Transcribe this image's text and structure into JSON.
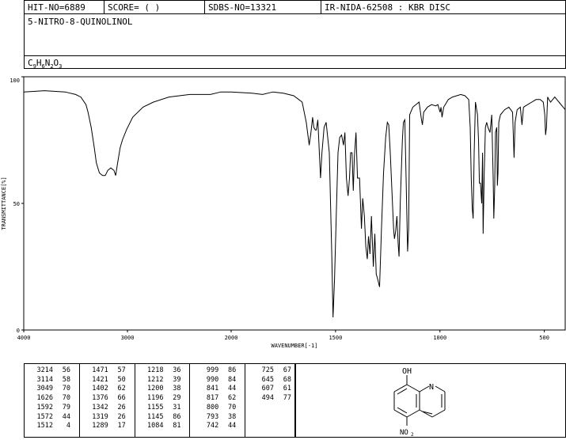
{
  "header": {
    "hit": "HIT-NO=6889",
    "score": "SCORE=  (   )",
    "sdbs": "SDBS-NO=13321",
    "ir": "IR-NIDA-62508 : KBR DISC"
  },
  "compound": {
    "name": "5-NITRO-8-QUINOLINOL",
    "formula_parts": [
      "C",
      "9",
      "H",
      "6",
      "N",
      "2",
      "O",
      "3"
    ]
  },
  "chart_data": {
    "type": "line",
    "xlabel": "WAVENUMBER[-1]",
    "ylabel": "TRANSMITTANCE[%]",
    "xlim": [
      4000,
      400
    ],
    "ylim": [
      0,
      100
    ],
    "x_ticks": [
      4000,
      3000,
      2000,
      1500,
      1000,
      500
    ],
    "y_ticks": [
      0,
      50,
      100
    ],
    "series": [
      {
        "points": [
          [
            4000,
            94
          ],
          [
            3800,
            94.5
          ],
          [
            3600,
            94
          ],
          [
            3500,
            93
          ],
          [
            3450,
            92
          ],
          [
            3400,
            89
          ],
          [
            3380,
            86
          ],
          [
            3350,
            80
          ],
          [
            3320,
            72
          ],
          [
            3300,
            66
          ],
          [
            3270,
            62
          ],
          [
            3240,
            61
          ],
          [
            3214,
            61
          ],
          [
            3190,
            63
          ],
          [
            3160,
            64
          ],
          [
            3130,
            63
          ],
          [
            3114,
            61
          ],
          [
            3095,
            66
          ],
          [
            3070,
            72
          ],
          [
            3049,
            75
          ],
          [
            3010,
            79
          ],
          [
            2950,
            84
          ],
          [
            2850,
            88
          ],
          [
            2750,
            90
          ],
          [
            2600,
            92
          ],
          [
            2400,
            93
          ],
          [
            2200,
            93
          ],
          [
            2100,
            94
          ],
          [
            2000,
            94
          ],
          [
            1900,
            93.5
          ],
          [
            1850,
            93
          ],
          [
            1800,
            94
          ],
          [
            1750,
            93.5
          ],
          [
            1700,
            92.5
          ],
          [
            1660,
            90
          ],
          [
            1640,
            82
          ],
          [
            1626,
            73
          ],
          [
            1618,
            78
          ],
          [
            1610,
            84
          ],
          [
            1604,
            80
          ],
          [
            1597,
            79
          ],
          [
            1592,
            79
          ],
          [
            1585,
            83
          ],
          [
            1572,
            60
          ],
          [
            1565,
            70
          ],
          [
            1555,
            80
          ],
          [
            1545,
            82
          ],
          [
            1530,
            70
          ],
          [
            1518,
            30
          ],
          [
            1512,
            5
          ],
          [
            1505,
            20
          ],
          [
            1495,
            50
          ],
          [
            1488,
            70
          ],
          [
            1480,
            76
          ],
          [
            1471,
            77
          ],
          [
            1462,
            73
          ],
          [
            1455,
            78
          ],
          [
            1448,
            60
          ],
          [
            1440,
            53
          ],
          [
            1433,
            60
          ],
          [
            1428,
            70
          ],
          [
            1421,
            70
          ],
          [
            1415,
            55
          ],
          [
            1410,
            68
          ],
          [
            1402,
            78
          ],
          [
            1395,
            60
          ],
          [
            1385,
            60
          ],
          [
            1376,
            40
          ],
          [
            1370,
            52
          ],
          [
            1362,
            45
          ],
          [
            1355,
            33
          ],
          [
            1348,
            28
          ],
          [
            1342,
            37
          ],
          [
            1335,
            30
          ],
          [
            1328,
            45
          ],
          [
            1319,
            25
          ],
          [
            1312,
            38
          ],
          [
            1305,
            22
          ],
          [
            1298,
            20
          ],
          [
            1289,
            17
          ],
          [
            1280,
            40
          ],
          [
            1270,
            62
          ],
          [
            1260,
            76
          ],
          [
            1252,
            82
          ],
          [
            1245,
            81
          ],
          [
            1238,
            70
          ],
          [
            1230,
            55
          ],
          [
            1222,
            40
          ],
          [
            1218,
            36
          ],
          [
            1212,
            39
          ],
          [
            1206,
            45
          ],
          [
            1200,
            34
          ],
          [
            1196,
            29
          ],
          [
            1190,
            50
          ],
          [
            1180,
            75
          ],
          [
            1175,
            82
          ],
          [
            1168,
            83
          ],
          [
            1162,
            60
          ],
          [
            1155,
            31
          ],
          [
            1150,
            40
          ],
          [
            1145,
            85
          ],
          [
            1140,
            86
          ],
          [
            1130,
            88
          ],
          [
            1100,
            90
          ],
          [
            1090,
            84
          ],
          [
            1084,
            81
          ],
          [
            1078,
            86
          ],
          [
            1060,
            88
          ],
          [
            1040,
            89
          ],
          [
            1020,
            88.5
          ],
          [
            1010,
            89
          ],
          [
            999,
            86
          ],
          [
            995,
            88
          ],
          [
            990,
            84
          ],
          [
            982,
            88
          ],
          [
            960,
            91
          ],
          [
            940,
            92
          ],
          [
            920,
            92.5
          ],
          [
            900,
            93
          ],
          [
            880,
            92.5
          ],
          [
            862,
            91
          ],
          [
            855,
            80
          ],
          [
            850,
            60
          ],
          [
            845,
            48
          ],
          [
            841,
            44
          ],
          [
            836,
            70
          ],
          [
            830,
            90
          ],
          [
            820,
            85
          ],
          [
            815,
            75
          ],
          [
            811,
            58
          ],
          [
            806,
            58
          ],
          [
            800,
            50
          ],
          [
            796,
            70
          ],
          [
            793,
            38
          ],
          [
            788,
            62
          ],
          [
            782,
            80
          ],
          [
            776,
            82
          ],
          [
            770,
            80
          ],
          [
            760,
            78
          ],
          [
            752,
            85
          ],
          [
            745,
            60
          ],
          [
            742,
            44
          ],
          [
            738,
            56
          ],
          [
            734,
            78
          ],
          [
            728,
            80
          ],
          [
            725,
            57
          ],
          [
            722,
            62
          ],
          [
            718,
            82
          ],
          [
            710,
            85
          ],
          [
            690,
            87
          ],
          [
            670,
            88
          ],
          [
            652,
            86
          ],
          [
            645,
            68
          ],
          [
            640,
            82
          ],
          [
            630,
            87
          ],
          [
            615,
            88
          ],
          [
            607,
            81
          ],
          [
            600,
            88
          ],
          [
            580,
            89
          ],
          [
            560,
            90
          ],
          [
            540,
            91
          ],
          [
            520,
            91
          ],
          [
            505,
            90
          ],
          [
            498,
            85
          ],
          [
            494,
            77
          ],
          [
            490,
            80
          ],
          [
            484,
            92
          ],
          [
            478,
            91
          ],
          [
            470,
            90
          ],
          [
            460,
            91
          ],
          [
            450,
            92
          ],
          [
            430,
            90
          ],
          [
            410,
            88
          ],
          [
            400,
            87
          ]
        ]
      }
    ]
  },
  "peaks": [
    [
      "3214",
      "56"
    ],
    [
      "3114",
      "58"
    ],
    [
      "3049",
      "70"
    ],
    [
      "1626",
      "70"
    ],
    [
      "1592",
      "79"
    ],
    [
      "1572",
      "44"
    ],
    [
      "1512",
      "4"
    ],
    [
      "1471",
      "57"
    ],
    [
      "1421",
      "50"
    ],
    [
      "1402",
      "62"
    ],
    [
      "1376",
      "66"
    ],
    [
      "1342",
      "26"
    ],
    [
      "1319",
      "26"
    ],
    [
      "1289",
      "17"
    ],
    [
      "1218",
      "36"
    ],
    [
      "1212",
      "39"
    ],
    [
      "1200",
      "38"
    ],
    [
      "1196",
      "29"
    ],
    [
      "1155",
      "31"
    ],
    [
      "1145",
      "86"
    ],
    [
      "1084",
      "81"
    ],
    [
      "999",
      "86"
    ],
    [
      "990",
      "84"
    ],
    [
      "841",
      "44"
    ],
    [
      "817",
      "62"
    ],
    [
      "800",
      "70"
    ],
    [
      "793",
      "38"
    ],
    [
      "742",
      "44"
    ],
    [
      "725",
      "67"
    ],
    [
      "645",
      "68"
    ],
    [
      "607",
      "61"
    ],
    [
      "494",
      "77"
    ]
  ],
  "structure_labels": {
    "hydroxyl": "OH",
    "nitrogen": "N",
    "nitro": "NO",
    "nitro_sub": "2"
  }
}
